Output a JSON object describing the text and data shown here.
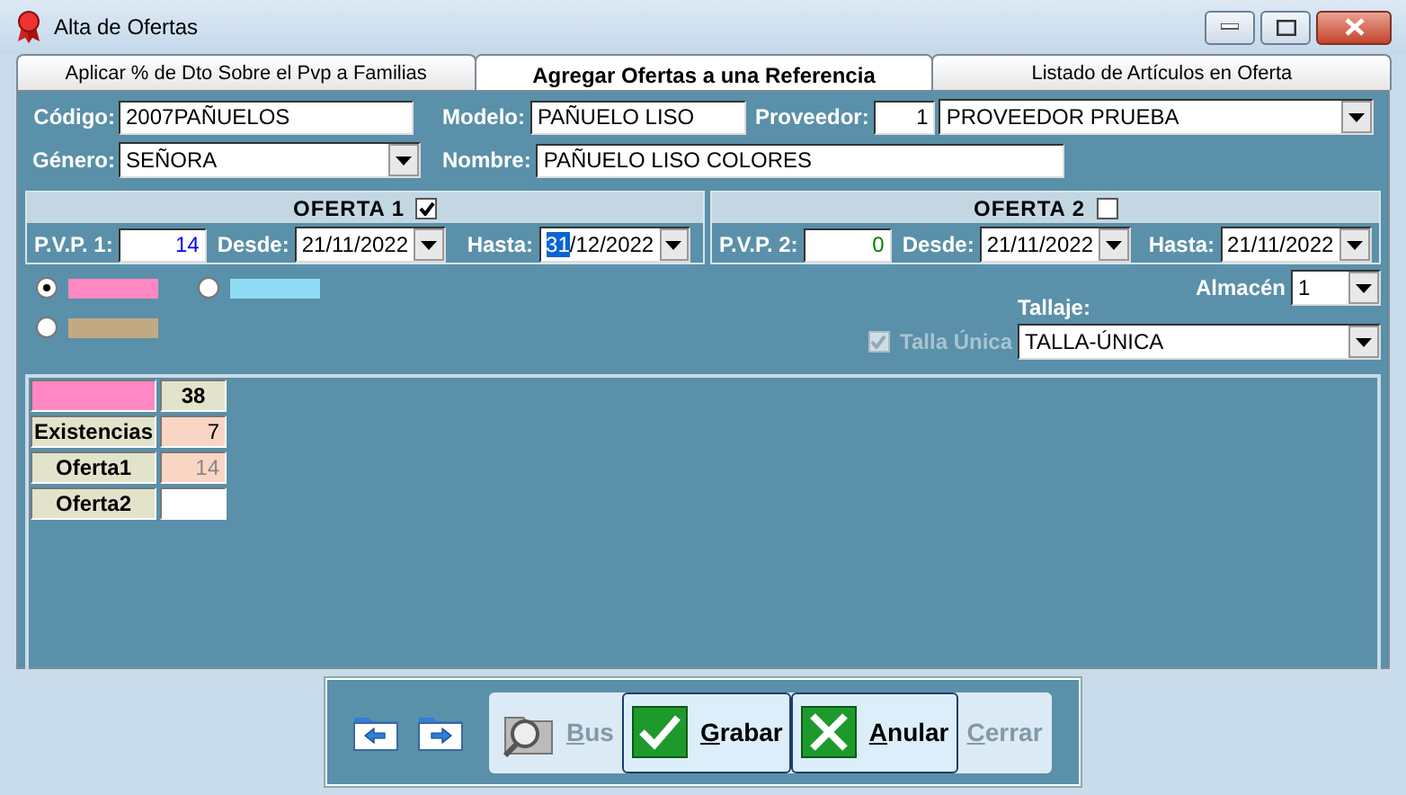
{
  "window": {
    "title": "Alta de Ofertas"
  },
  "tabs": [
    {
      "label": "Aplicar % de Dto Sobre el Pvp a Familias",
      "selected": false
    },
    {
      "label": "Agregar Ofertas a una Referencia",
      "selected": true
    },
    {
      "label": "Listado de Artículos en Oferta",
      "selected": false
    }
  ],
  "form": {
    "codigo": {
      "label": "Código:",
      "value": "2007PAÑUELOS"
    },
    "modelo": {
      "label": "Modelo:",
      "value": "PAÑUELO LISO"
    },
    "proveedor": {
      "label": "Proveedor:",
      "number": "1",
      "value": "PROVEEDOR PRUEBA"
    },
    "genero": {
      "label": "Género:",
      "value": "SEÑORA"
    },
    "nombre": {
      "label": "Nombre:",
      "value": "PAÑUELO LISO COLORES"
    }
  },
  "offers": [
    {
      "title": "OFERTA 1",
      "checked": true,
      "price_label": "P.V.P. 1:",
      "price": "14",
      "color": "#0000ff",
      "from_label": "Desde:",
      "from": "21/11/2022",
      "to_label": "Hasta:",
      "to": "31/12/2022",
      "focused": true
    },
    {
      "title": "OFERTA 2",
      "checked": false,
      "price_label": "P.V.P. 2:",
      "price": "0",
      "color": "#008000",
      "from_label": "Desde:",
      "from": "21/11/2022",
      "to_label": "Hasta:",
      "to": "21/11/2022",
      "focused": false
    }
  ],
  "colors": [
    {
      "color": "#ff88c2",
      "selected": true
    },
    {
      "color": "#c3a982",
      "selected": false
    },
    {
      "color": "#8edcf4",
      "selected": false
    }
  ],
  "almacen": {
    "label": "Almacén",
    "value": "1"
  },
  "tallaje": {
    "label": "Tallaje:",
    "value": "TALLA-ÚNICA"
  },
  "talla_unica": {
    "label": "Talla Única",
    "checked": true,
    "disabled": true
  },
  "stock_grid": {
    "color": "#ff88c2",
    "value": "38",
    "rows": [
      {
        "label": "Existencias",
        "value": "7",
        "kind": "readonly",
        "disabled": false
      },
      {
        "label": "Oferta1",
        "value": "14",
        "kind": "readonly",
        "disabled": true
      },
      {
        "label": "Oferta2",
        "kind": "editable",
        "disabled": false
      }
    ]
  },
  "toolbar": {
    "buttons": [
      {
        "label": "Bus",
        "kind": "search",
        "disabled": true
      },
      {
        "label": "Grabar",
        "kind": "save",
        "disabled": false
      },
      {
        "label": "Anular",
        "kind": "cancel",
        "disabled": false
      },
      {
        "label": "Cerrar",
        "kind": "close",
        "disabled": true
      }
    ]
  }
}
